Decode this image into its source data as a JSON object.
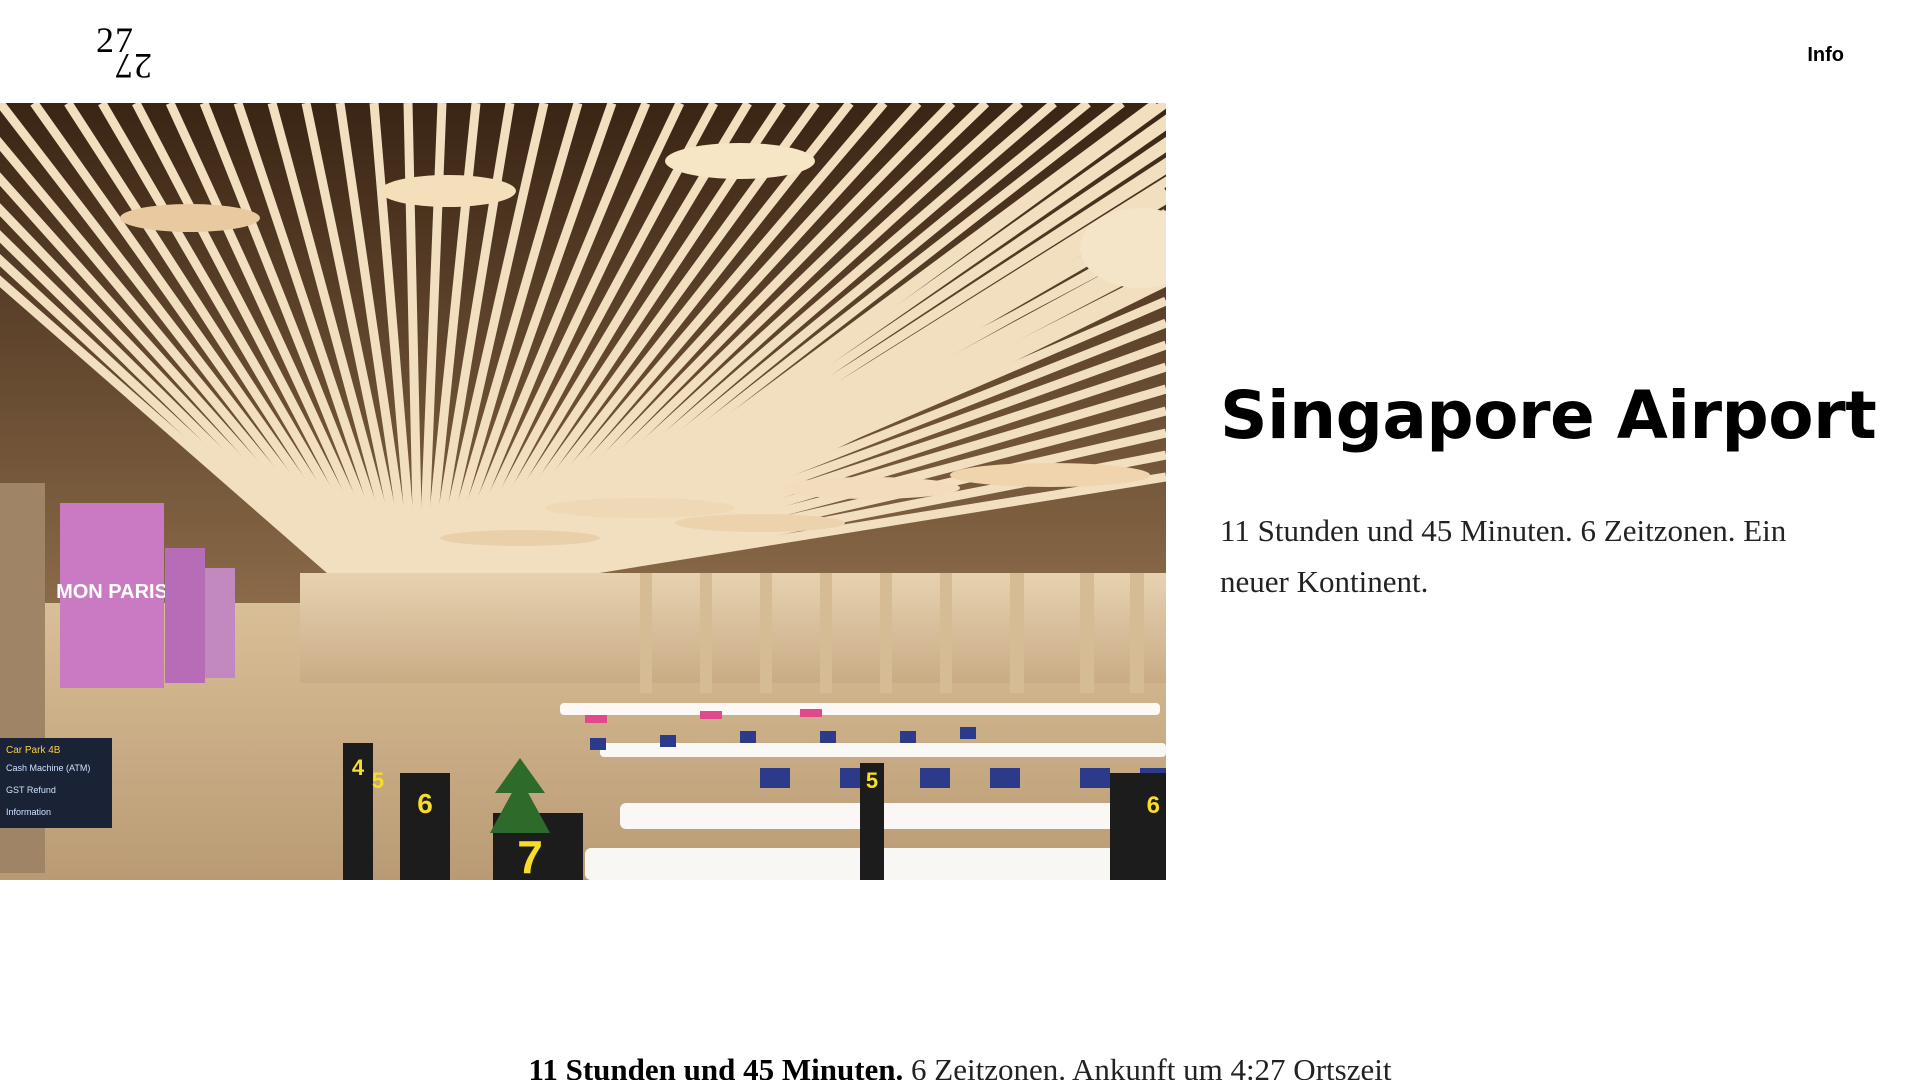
{
  "header": {
    "logo_top": "27",
    "logo_bottom": "27",
    "nav_info": "Info"
  },
  "hero": {
    "alt": "Singapore Changi Airport departure hall with slatted wooden ceiling",
    "signs": {
      "s4": "4",
      "s5a": "5",
      "s6": "6",
      "s7": "7",
      "s5b": "5",
      "s6b": "6",
      "mon_paris": "MON PARIS",
      "car_park": "Car Park 4B",
      "cash": "Cash Machine (ATM)",
      "gst": "GST Refund",
      "info": "Information"
    }
  },
  "article": {
    "title": "Singapore Airport",
    "description": "11 Stunden und 45 Minuten. 6 Zeitzonen. Ein neuer Kontinent."
  },
  "caption": {
    "bold": "11 Stunden und 45 Minuten.",
    "rest": " 6 Zeitzonen. Ankunft um 4:27 Ortszeit"
  }
}
